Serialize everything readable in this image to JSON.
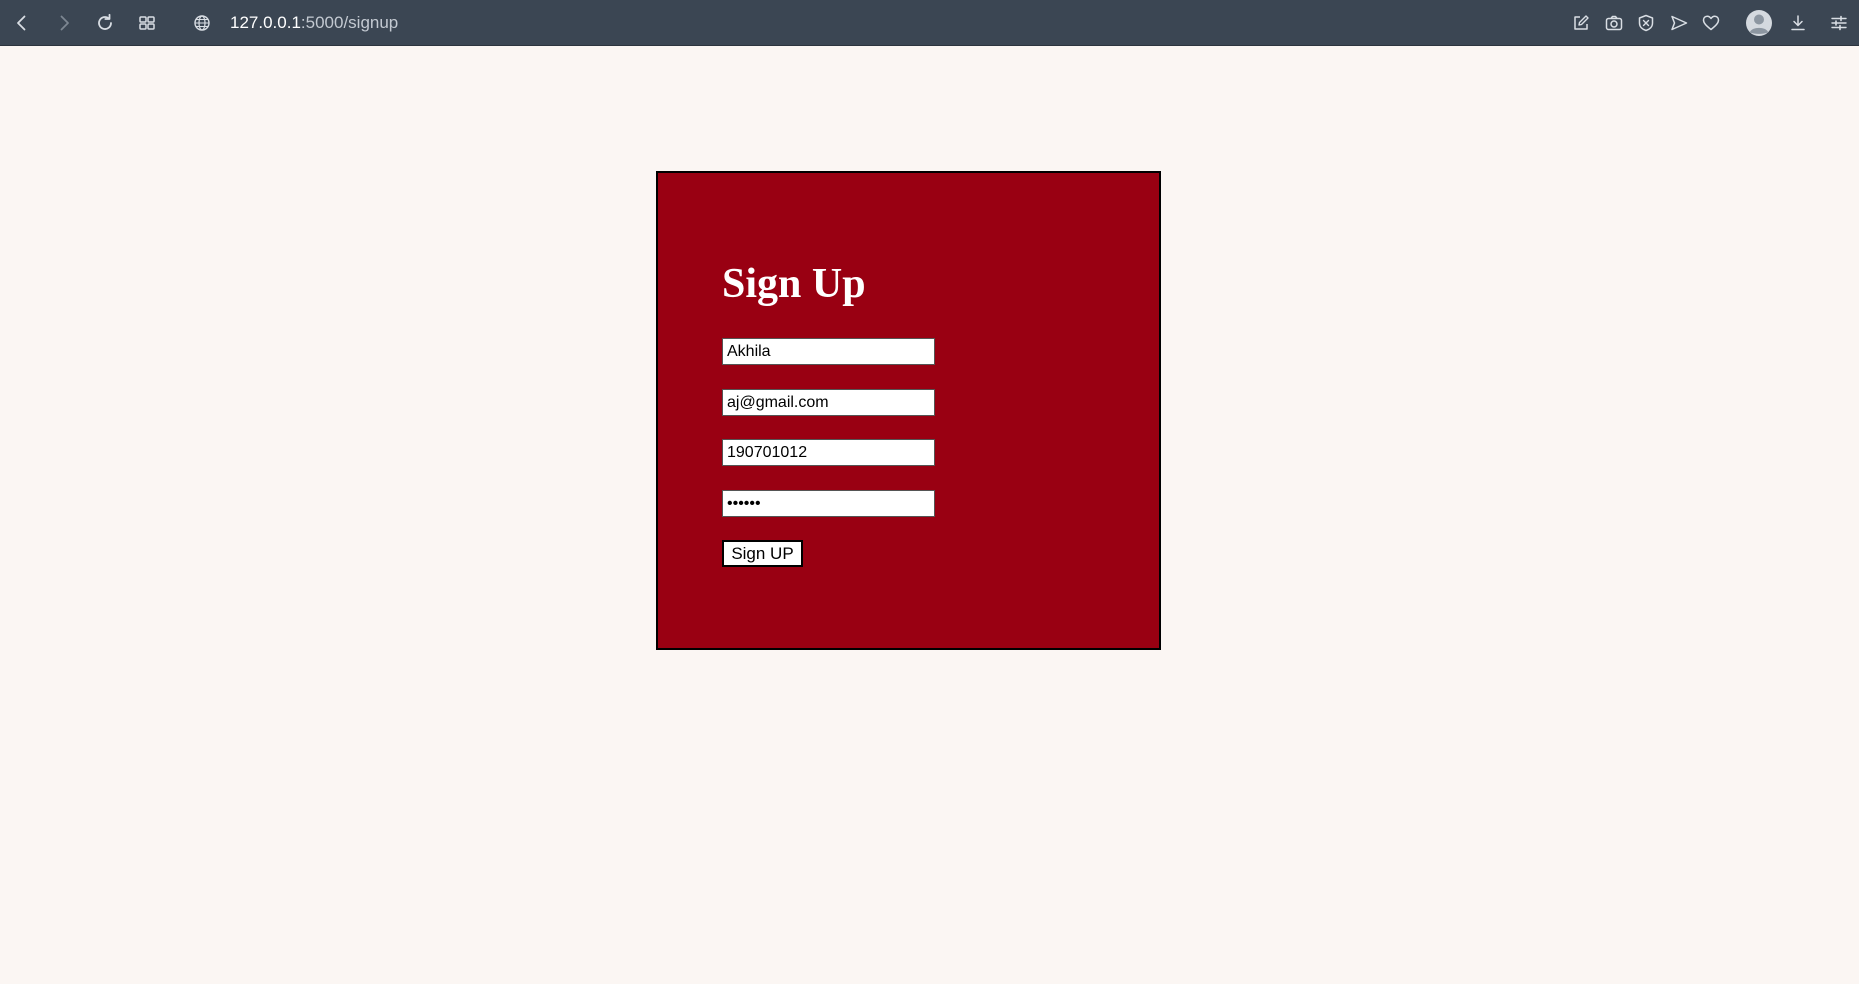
{
  "browser": {
    "url_host": "127.0.0.1",
    "url_path": ":5000/signup",
    "bar_color": "#3b4653"
  },
  "form": {
    "title": "Sign Up",
    "name_value": "Akhila",
    "email_value": "aj@gmail.com",
    "id_value": "190701012",
    "password_value": "******",
    "submit_label": "Sign UP",
    "card_color": "#990012",
    "page_background": "#fbf6f3"
  },
  "icons": {
    "back": "back-arrow-icon",
    "forward": "forward-arrow-icon",
    "reload": "reload-icon",
    "tabs": "tab-grid-icon",
    "site_info": "globe-icon",
    "edit": "edit-icon",
    "screenshot": "camera-icon",
    "shield": "shield-icon",
    "send": "send-icon",
    "favorite": "heart-icon",
    "profile": "profile-icon",
    "download": "download-icon",
    "settings": "sliders-icon"
  }
}
